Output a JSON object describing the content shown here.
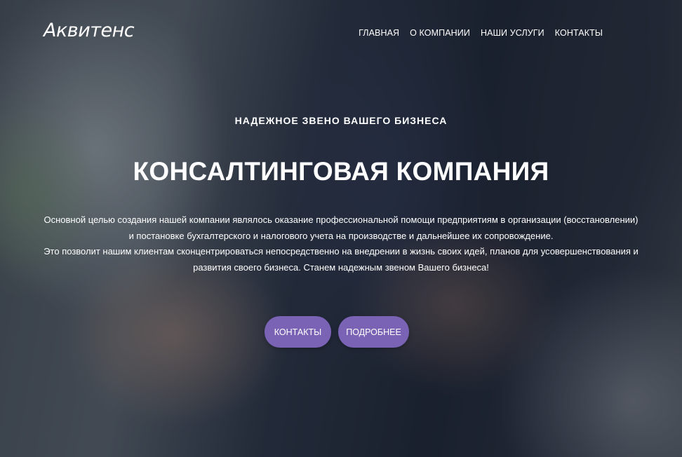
{
  "brand": {
    "logo_text": "Аквитенс"
  },
  "nav": {
    "items": [
      "ГЛАВНАЯ",
      "О КОМПАНИИ",
      "НАШИ УСЛУГИ",
      "КОНТАКТЫ"
    ]
  },
  "hero": {
    "eyebrow": "НАДЕЖНОЕ ЗВЕНО ВАШЕГО БИЗНЕСА",
    "headline": "КОНСАЛТИНГОВАЯ КОМПАНИЯ",
    "paragraph_1": "Основной целью создания нашей компании являлось оказание профессиональной помощи предприятиям в организации (восстановлении) и постановке бухгалтерского и налогового учета на производстве и дальнейшее их сопровождение.",
    "paragraph_2": "Это позволит нашим клиентам сконцентрироваться непосредственно на внедрении в жизнь своих идей, планов для усовершенствования и развития своего бизнеса. Станем надежным звеном Вашего бизнеса!",
    "button_contacts": "КОНТАКТЫ",
    "button_more": "ПОДРОБНЕЕ"
  },
  "colors": {
    "accent": "#7a62b5",
    "text": "#ffffff"
  }
}
